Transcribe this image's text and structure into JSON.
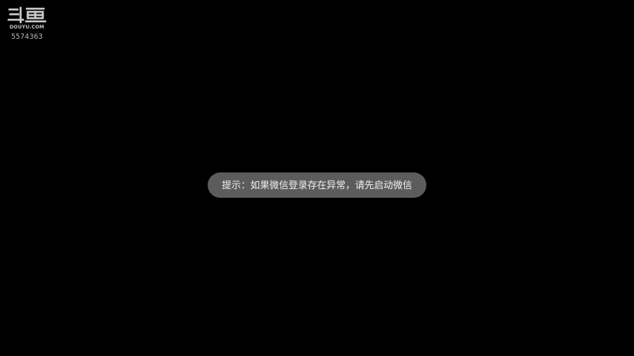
{
  "watermark": {
    "logo_text": "斗鱼",
    "domain": "DOUYU.COM",
    "room_id": "5574363"
  },
  "toast": {
    "message": "提示：如果微信登录存在异常，请先启动微信"
  },
  "colors": {
    "background": "#000000",
    "toast_background": "#5c5c5c",
    "toast_text": "#f2f2f2",
    "watermark_text": "#e6e6e6"
  },
  "icons": {
    "logo": "douyu-logo-icon"
  }
}
